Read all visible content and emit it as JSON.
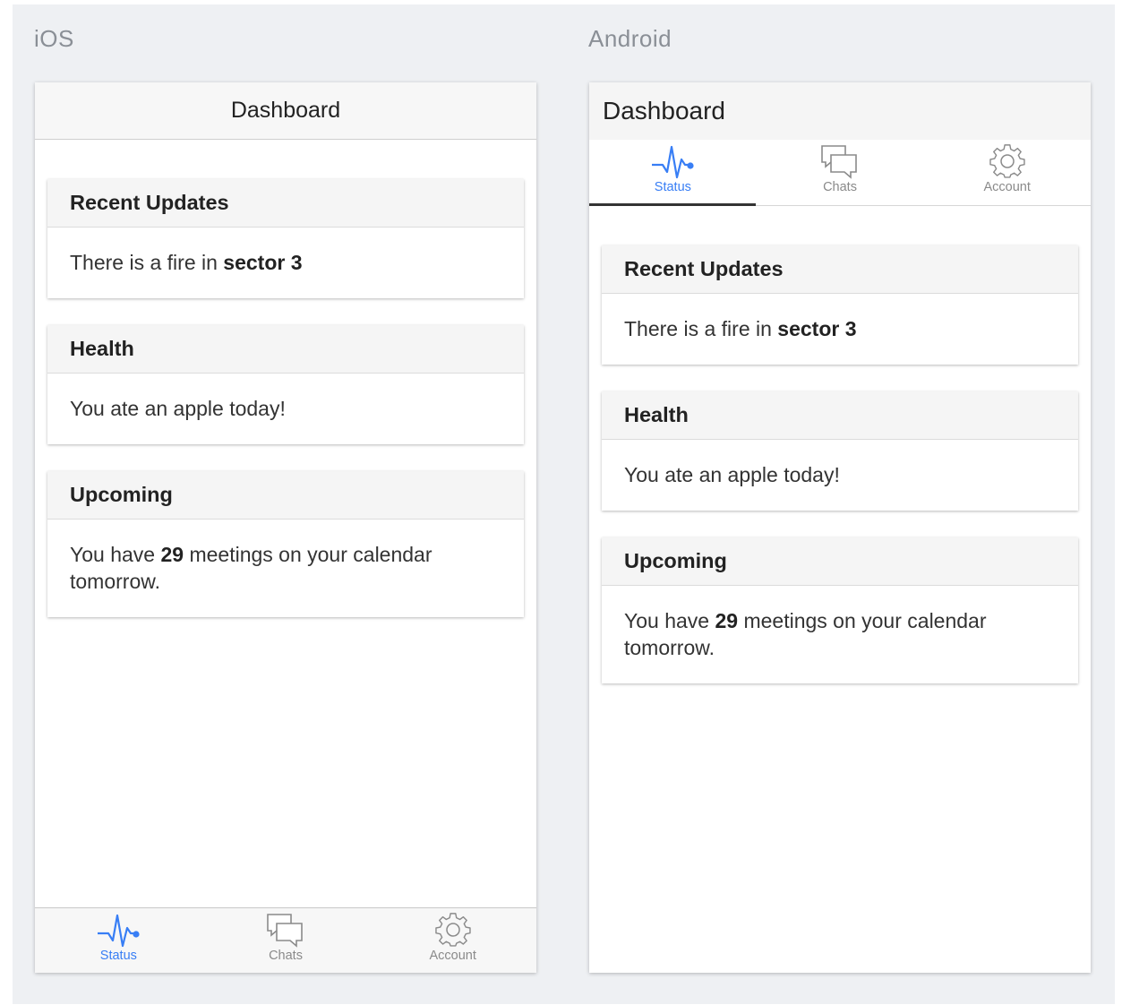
{
  "labels": {
    "ios": "iOS",
    "android": "Android"
  },
  "colors": {
    "active": "#387ef5",
    "inactive": "#8a8a8a",
    "backdrop": "#eef0f3"
  },
  "header": {
    "title": "Dashboard"
  },
  "tabs": [
    {
      "label": "Status",
      "icon": "pulse-icon",
      "active": true
    },
    {
      "label": "Chats",
      "icon": "chat-bubbles-icon",
      "active": false
    },
    {
      "label": "Account",
      "icon": "gear-icon",
      "active": false
    }
  ],
  "cards": {
    "recent": {
      "title": "Recent Updates",
      "text_before": "There is a fire in ",
      "text_bold": "sector 3"
    },
    "health": {
      "title": "Health",
      "text": "You ate an apple today!"
    },
    "upcoming": {
      "title": "Upcoming",
      "text_before": "You have ",
      "text_bold": "29",
      "text_after": " meetings on your calendar tomorrow."
    }
  }
}
